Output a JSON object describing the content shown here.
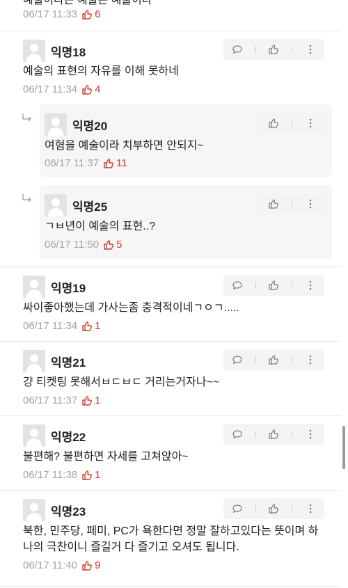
{
  "partial": {
    "text": "예술이라는 예술은 예술이다",
    "time": "06/17 11:33",
    "likes": "6"
  },
  "comments": [
    {
      "author": "익명18",
      "body": "예술의 표현의 자유를 이해 못하네",
      "time": "06/17 11:34",
      "likes": "4",
      "replies": [
        {
          "author": "익명20",
          "body": "여혐을 예술이라 치부하면 안되지~",
          "time": "06/17 11:37",
          "likes": "11"
        },
        {
          "author": "익명25",
          "body": "ㄱㅂ년이 예술의 표현..?",
          "time": "06/17 11:50",
          "likes": "5"
        }
      ]
    },
    {
      "author": "익명19",
      "body": "싸이좋아했는데 가사는좀  충격적이네ㄱㅇㄱ.....",
      "time": "06/17 11:34",
      "likes": "1"
    },
    {
      "author": "익명21",
      "body": "걍 티켓팅 못해서ㅂㄷㅂㄷ 거리는거자나~~",
      "time": "06/17 11:37",
      "likes": "1"
    },
    {
      "author": "익명22",
      "body": "불편해? 불편하면 자세를 고쳐앉아~",
      "time": "06/17 11:38",
      "likes": "1"
    },
    {
      "author": "익명23",
      "body": "북한, 민주당, 페미, PC가 욕한다면 정말 잘하고있다는 뜻이며 하나의 극찬이니 즐길거 다 즐기고 오셔도 됩니다.",
      "time": "06/17 11:40",
      "likes": "9"
    }
  ],
  "icons": {
    "comment": "speech-bubble-icon",
    "like": "thumbs-up-icon",
    "more": "more-vertical-icon",
    "reply": "reply-arrow-icon"
  },
  "colors": {
    "like_red": "#d03a2a",
    "meta_gray": "#a3a3a3",
    "action_bg": "#f4f4f4",
    "reply_bg": "#f6f6f6"
  }
}
